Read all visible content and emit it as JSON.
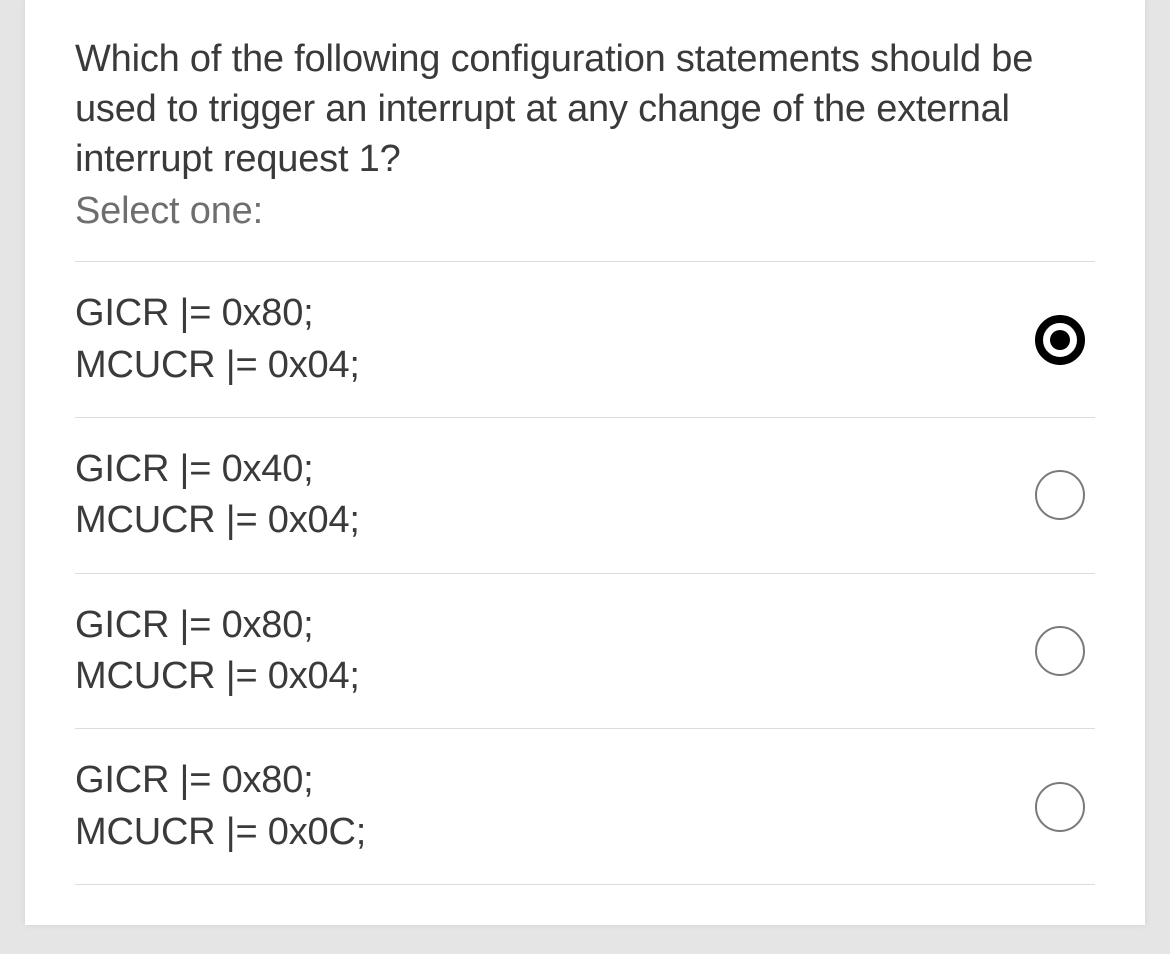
{
  "question": "Which of the following configuration statements should be used to trigger an interrupt at any change of the external interrupt request 1?",
  "select_prompt": "Select one:",
  "options": [
    {
      "line1": "GICR |= 0x80;",
      "line2": "MCUCR |= 0x04;",
      "selected": true
    },
    {
      "line1": "GICR |= 0x40;",
      "line2": "MCUCR |= 0x04;",
      "selected": false
    },
    {
      "line1": "GICR |= 0x80;",
      "line2": "MCUCR |= 0x04;",
      "selected": false
    },
    {
      "line1": "GICR |= 0x80;",
      "line2": "MCUCR |= 0x0C;",
      "selected": false
    }
  ]
}
